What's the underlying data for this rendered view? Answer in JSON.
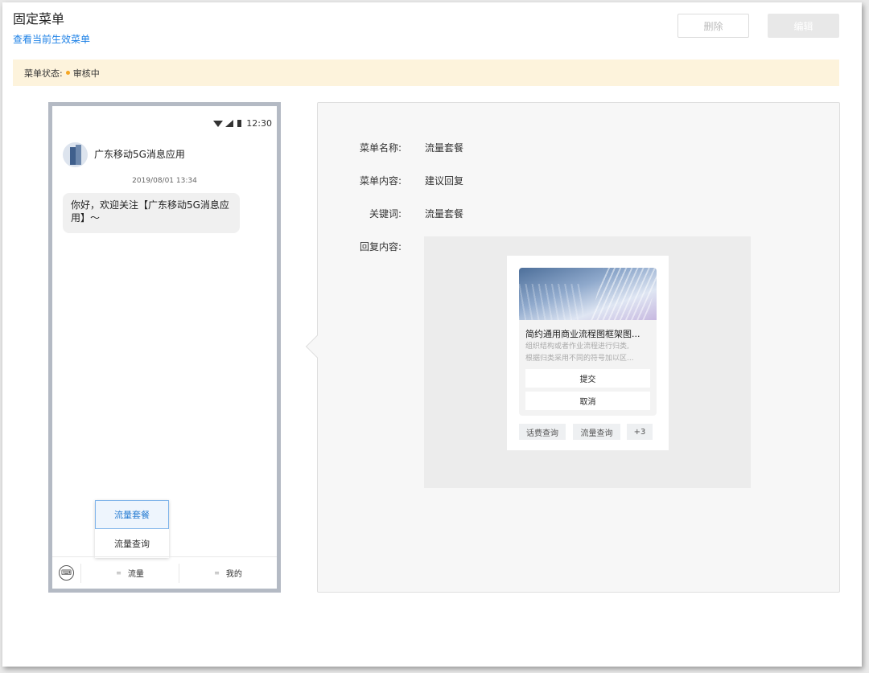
{
  "header": {
    "title": "固定菜单",
    "link": "查看当前生效菜单",
    "delete_label": "删除",
    "edit_label": "编辑"
  },
  "status": {
    "label": "菜单状态:",
    "value": "审核中",
    "color": "#f5a623"
  },
  "phone": {
    "time": "12:30",
    "app_name": "广东移动5G消息应用",
    "timestamp": "2019/08/01 13:34",
    "message": "你好，欢迎关注【广东移动5G消息应用】～",
    "popup_menu": [
      "流量套餐",
      "流量查询"
    ],
    "bottom_tabs": [
      "流量",
      "我的"
    ]
  },
  "detail": {
    "name_label": "菜单名称:",
    "name_value": "流量套餐",
    "content_label": "菜单内容:",
    "content_value": "建议回复",
    "keyword_label": "关键词:",
    "keyword_value": "流量套餐",
    "reply_label": "回复内容:"
  },
  "card": {
    "title": "简约通用商业流程图框架图...",
    "desc_line1": "组织结构或者作业流程进行归类,",
    "desc_line2": "根据归类采用不同的符号加以区...",
    "submit_label": "提交",
    "cancel_label": "取消",
    "chips": [
      "话费查询",
      "流量查询",
      "+3"
    ]
  }
}
